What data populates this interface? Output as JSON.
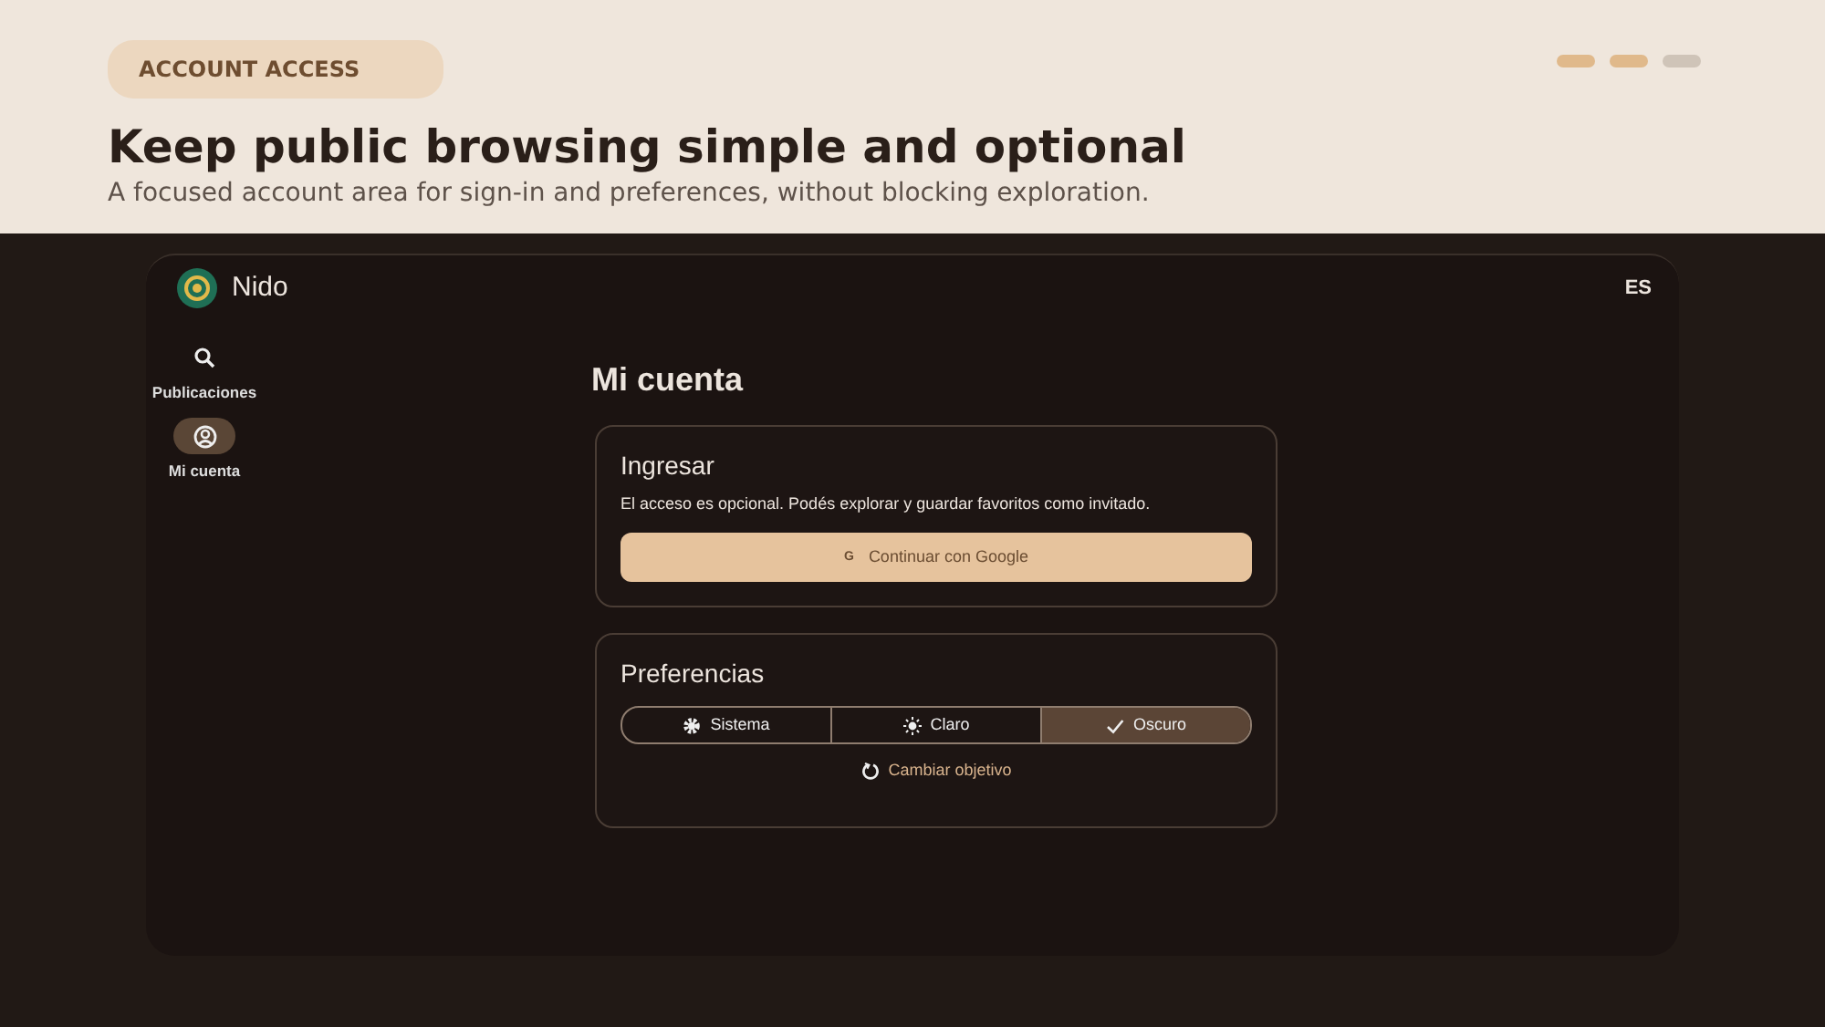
{
  "header": {
    "tag": "ACCOUNT ACCESS",
    "title": "Keep public browsing simple and optional",
    "subtitle": "A focused account area for sign-in and preferences, without blocking exploration.",
    "steps": [
      {
        "done": true
      },
      {
        "done": true
      },
      {
        "done": false
      }
    ]
  },
  "app": {
    "brand": "Nido",
    "language": "ES",
    "sidebar": {
      "items": [
        {
          "kind": "search",
          "label": "Publicaciones",
          "selected": false
        },
        {
          "kind": "account",
          "label": "Mi cuenta",
          "selected": true
        }
      ]
    },
    "page_title": "Mi cuenta",
    "signin": {
      "title": "Ingresar",
      "text": "El acceso es opcional. Podés explorar y guardar favoritos como invitado.",
      "button_icon": "G",
      "button": "Continuar con Google"
    },
    "preferences": {
      "title": "Preferencias",
      "themes": [
        {
          "kind": "system",
          "label": "Sistema",
          "selected": false
        },
        {
          "kind": "light",
          "label": "Claro",
          "selected": false
        },
        {
          "kind": "dark",
          "label": "Oscuro",
          "selected": true
        }
      ],
      "link": "Cambiar objetivo"
    }
  }
}
